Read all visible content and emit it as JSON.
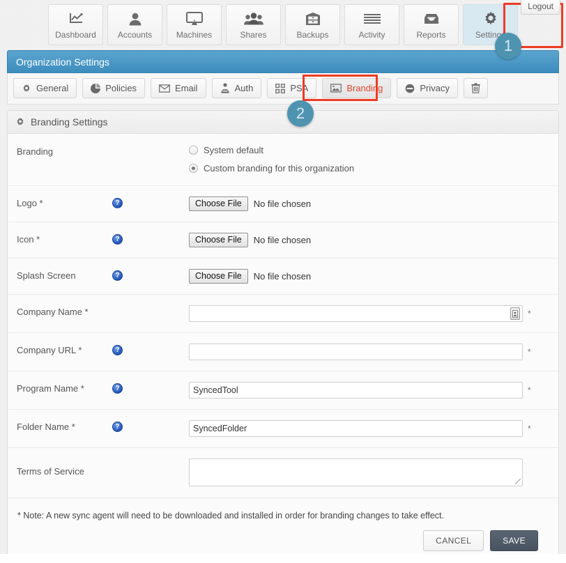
{
  "account": {
    "logout_label": "Logout"
  },
  "topnav": {
    "items": [
      {
        "label": "Dashboard",
        "icon": "chart-line-icon",
        "active": false
      },
      {
        "label": "Accounts",
        "icon": "user-icon",
        "active": false
      },
      {
        "label": "Machines",
        "icon": "monitor-icon",
        "active": false
      },
      {
        "label": "Shares",
        "icon": "users-group-icon",
        "active": false
      },
      {
        "label": "Backups",
        "icon": "archive-box-icon",
        "active": false
      },
      {
        "label": "Activity",
        "icon": "lines-list-icon",
        "active": false
      },
      {
        "label": "Reports",
        "icon": "inbox-tray-icon",
        "active": false
      },
      {
        "label": "Settings",
        "icon": "gear-icon",
        "active": true
      }
    ]
  },
  "callouts": {
    "step1": "1",
    "step2": "2",
    "highlight_color": "#ee3b24",
    "badge_color": "#4e94b0"
  },
  "org_header": {
    "title": "Organization Settings",
    "accent": "#3d8dbd"
  },
  "subtabs": {
    "items": [
      {
        "label": "General",
        "icon": "gear-icon",
        "active": false
      },
      {
        "label": "Policies",
        "icon": "pie-chart-icon",
        "active": false
      },
      {
        "label": "Email",
        "icon": "envelope-icon",
        "active": false
      },
      {
        "label": "Auth",
        "icon": "person-key-icon",
        "active": false
      },
      {
        "label": "PSA",
        "icon": "grid-squares-icon",
        "active": false
      },
      {
        "label": "Branding",
        "icon": "image-picture-icon",
        "active": true
      },
      {
        "label": "Privacy",
        "icon": "no-entry-icon",
        "active": false
      },
      {
        "label": "",
        "icon": "trash-icon",
        "active": false
      }
    ]
  },
  "panel": {
    "title": "Branding Settings",
    "title_icon": "gear-icon",
    "rows": {
      "branding": {
        "label": "Branding",
        "options": [
          {
            "label": "System default",
            "selected": false
          },
          {
            "label": "Custom branding for this organization",
            "selected": true
          }
        ]
      },
      "logo": {
        "label": "Logo *",
        "help": "?",
        "button": "Choose File",
        "status": "No file chosen"
      },
      "icon": {
        "label": "Icon *",
        "help": "?",
        "button": "Choose File",
        "status": "No file chosen"
      },
      "splash": {
        "label": "Splash Screen",
        "help": "?",
        "button": "Choose File",
        "status": "No file chosen"
      },
      "company_name": {
        "label": "Company Name *",
        "value": "",
        "placeholder": "",
        "required_mark": "*",
        "widget_icon": "contact-card-icon"
      },
      "company_url": {
        "label": "Company URL *",
        "help": "?",
        "value": "",
        "placeholder": "",
        "required_mark": "*"
      },
      "program_name": {
        "label": "Program Name *",
        "help": "?",
        "value": "SyncedTool",
        "placeholder": "",
        "required_mark": "*"
      },
      "folder_name": {
        "label": "Folder Name *",
        "help": "?",
        "value": "SyncedFolder",
        "placeholder": "",
        "required_mark": "*"
      },
      "terms": {
        "label": "Terms of Service",
        "value": "",
        "placeholder": ""
      }
    },
    "note": "* Note: A new sync agent will need to be downloaded and installed in order for branding changes to take effect.",
    "cancel_label": "CANCEL",
    "save_label": "SAVE"
  }
}
